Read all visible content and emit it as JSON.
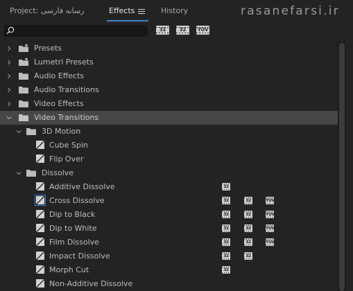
{
  "tabs": {
    "project": "Project: رسانه فارسی",
    "effects": "Effects",
    "history": "History"
  },
  "watermark": "rasanefarsi.ir",
  "search": {
    "value": "",
    "placeholder": ""
  },
  "filters": {
    "accelerated": "32",
    "bit32": "32",
    "yuv": "YUV"
  },
  "badges": {
    "accelerated": "32",
    "bit32": "32",
    "yuv": "YUV"
  },
  "tree": {
    "presets": "Presets",
    "lumetri_presets": "Lumetri Presets",
    "audio_effects": "Audio Effects",
    "audio_transitions": "Audio Transitions",
    "video_effects": "Video Effects",
    "video_transitions": "Video Transitions",
    "motion_3d": "3D Motion",
    "cube_spin": "Cube Spin",
    "flip_over": "Flip Over",
    "dissolve": "Dissolve",
    "additive_dissolve": "Additive Dissolve",
    "cross_dissolve": "Cross Dissolve",
    "dip_to_black": "Dip to Black",
    "dip_to_white": "Dip to White",
    "film_dissolve": "Film Dissolve",
    "impact_dissolve": "Impact Dissolve",
    "morph_cut": "Morph Cut",
    "non_additive_dissolve": "Non-Additive Dissolve"
  },
  "colors": {
    "panel_bg": "#232323",
    "selected_row": "#464646",
    "accent_blue": "#3b86d4",
    "text": "#bdbdbd"
  }
}
